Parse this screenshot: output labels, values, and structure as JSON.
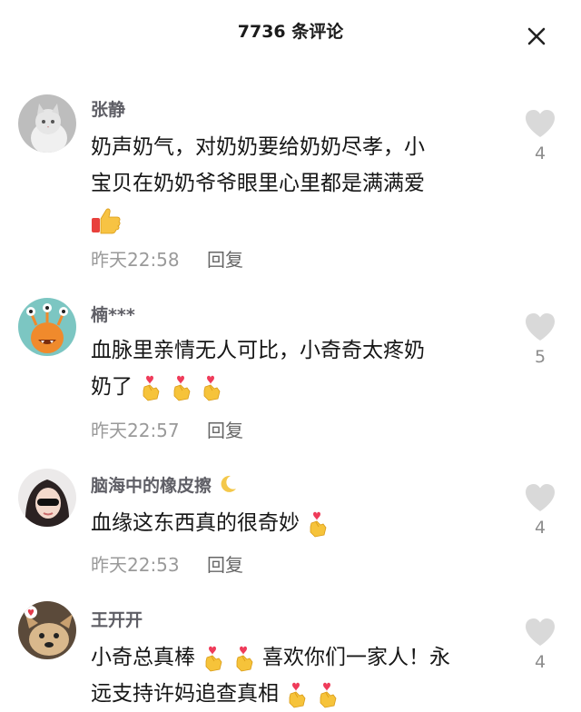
{
  "header": {
    "title": "7736 条评论"
  },
  "comments": [
    {
      "username": "张静",
      "text_line1": "奶声奶气，对奶奶要给奶奶尽孝，小",
      "text_line2": "宝贝在奶奶爷爷眼里心里都是满满爱",
      "time": "昨天22:58",
      "reply": "回复",
      "likes": "4",
      "emoji": [
        "thumbs-up"
      ]
    },
    {
      "username": "楠***",
      "text_line1": "血脉里亲情无人可比，小奇奇太疼奶",
      "text_line2": "奶了",
      "time": "昨天22:57",
      "reply": "回复",
      "likes": "5",
      "emoji": [
        "finger-heart",
        "finger-heart",
        "finger-heart"
      ]
    },
    {
      "username": "脑海中的橡皮擦",
      "text_line1": "血缘这东西真的很奇妙",
      "time": "昨天22:53",
      "reply": "回复",
      "likes": "4",
      "emoji": [
        "finger-heart"
      ]
    },
    {
      "username": "王开开",
      "text_line1_a": "小奇总真棒",
      "text_line1_b": "喜欢你们一家人！永",
      "text_line2": "远支持许妈追查真相",
      "likes": "4",
      "emoji": [
        "finger-heart",
        "finger-heart",
        "finger-heart",
        "finger-heart"
      ]
    }
  ],
  "colors": {
    "username": "#5f5f66",
    "meta": "#9a9a9a",
    "heart": "#d9d9d9"
  }
}
